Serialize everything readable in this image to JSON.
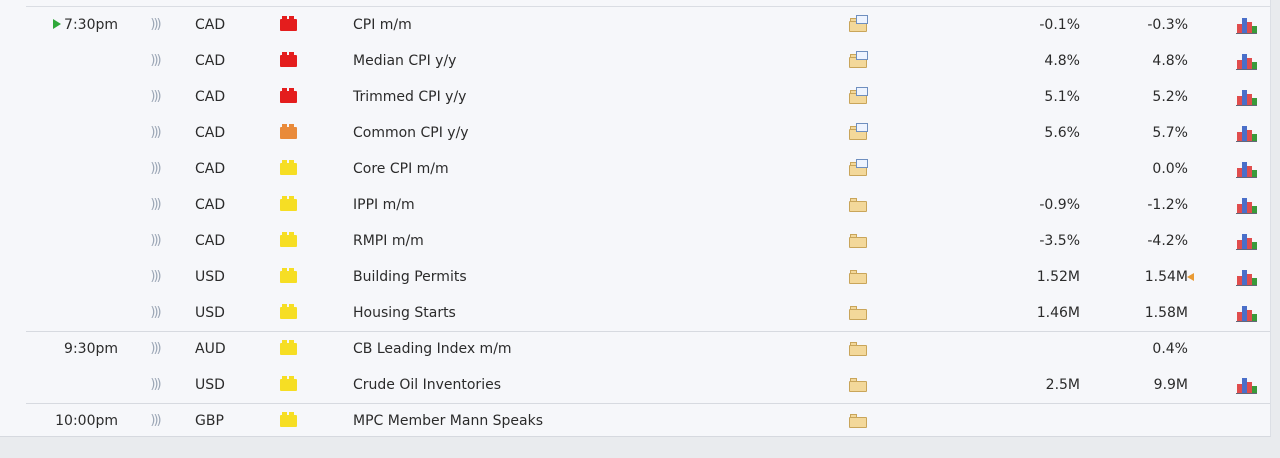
{
  "calendar": {
    "rows": [
      {
        "time": "7:30pm",
        "live": true,
        "currency": "CAD",
        "impact": "high",
        "impact_color": "#e41d1d",
        "event": "CPI m/m",
        "detail_icon": "folder-doc-icon",
        "actual": "-0.1%",
        "forecast": "-0.3%",
        "revised": false,
        "chart": true,
        "separator": false
      },
      {
        "time": "",
        "live": false,
        "currency": "CAD",
        "impact": "high",
        "impact_color": "#e41d1d",
        "event": "Median CPI y/y",
        "detail_icon": "folder-doc-icon",
        "actual": "4.8%",
        "forecast": "4.8%",
        "revised": false,
        "chart": true,
        "separator": false
      },
      {
        "time": "",
        "live": false,
        "currency": "CAD",
        "impact": "high",
        "impact_color": "#e41d1d",
        "event": "Trimmed CPI y/y",
        "detail_icon": "folder-doc-icon",
        "actual": "5.1%",
        "forecast": "5.2%",
        "revised": false,
        "chart": true,
        "separator": false
      },
      {
        "time": "",
        "live": false,
        "currency": "CAD",
        "impact": "medium",
        "impact_color": "#e98a3a",
        "event": "Common CPI y/y",
        "detail_icon": "folder-doc-icon",
        "actual": "5.6%",
        "forecast": "5.7%",
        "revised": false,
        "chart": true,
        "separator": false
      },
      {
        "time": "",
        "live": false,
        "currency": "CAD",
        "impact": "low",
        "impact_color": "#f6de24",
        "event": "Core CPI m/m",
        "detail_icon": "folder-doc-icon",
        "actual": "",
        "forecast": "0.0%",
        "revised": false,
        "chart": true,
        "separator": false
      },
      {
        "time": "",
        "live": false,
        "currency": "CAD",
        "impact": "low",
        "impact_color": "#f6de24",
        "event": "IPPI m/m",
        "detail_icon": "folder-icon",
        "actual": "-0.9%",
        "forecast": "-1.2%",
        "revised": false,
        "chart": true,
        "separator": false
      },
      {
        "time": "",
        "live": false,
        "currency": "CAD",
        "impact": "low",
        "impact_color": "#f6de24",
        "event": "RMPI m/m",
        "detail_icon": "folder-icon",
        "actual": "-3.5%",
        "forecast": "-4.2%",
        "revised": false,
        "chart": true,
        "separator": false
      },
      {
        "time": "",
        "live": false,
        "currency": "USD",
        "impact": "low",
        "impact_color": "#f6de24",
        "event": "Building Permits",
        "detail_icon": "folder-icon",
        "actual": "1.52M",
        "forecast": "1.54M",
        "revised": true,
        "chart": true,
        "separator": false
      },
      {
        "time": "",
        "live": false,
        "currency": "USD",
        "impact": "low",
        "impact_color": "#f6de24",
        "event": "Housing Starts",
        "detail_icon": "folder-icon",
        "actual": "1.46M",
        "forecast": "1.58M",
        "revised": false,
        "chart": true,
        "separator": false
      },
      {
        "time": "9:30pm",
        "live": false,
        "currency": "AUD",
        "impact": "low",
        "impact_color": "#f6de24",
        "event": "CB Leading Index m/m",
        "detail_icon": "folder-icon",
        "actual": "",
        "forecast": "0.4%",
        "revised": false,
        "chart": false,
        "separator": true
      },
      {
        "time": "",
        "live": false,
        "currency": "USD",
        "impact": "low",
        "impact_color": "#f6de24",
        "event": "Crude Oil Inventories",
        "detail_icon": "folder-icon",
        "actual": "2.5M",
        "forecast": "9.9M",
        "revised": false,
        "chart": true,
        "separator": false
      },
      {
        "time": "10:00pm",
        "live": false,
        "currency": "GBP",
        "impact": "low",
        "impact_color": "#f6de24",
        "event": "MPC Member Mann Speaks",
        "detail_icon": "folder-icon",
        "actual": "",
        "forecast": "",
        "revised": false,
        "chart": false,
        "separator": true
      }
    ]
  }
}
